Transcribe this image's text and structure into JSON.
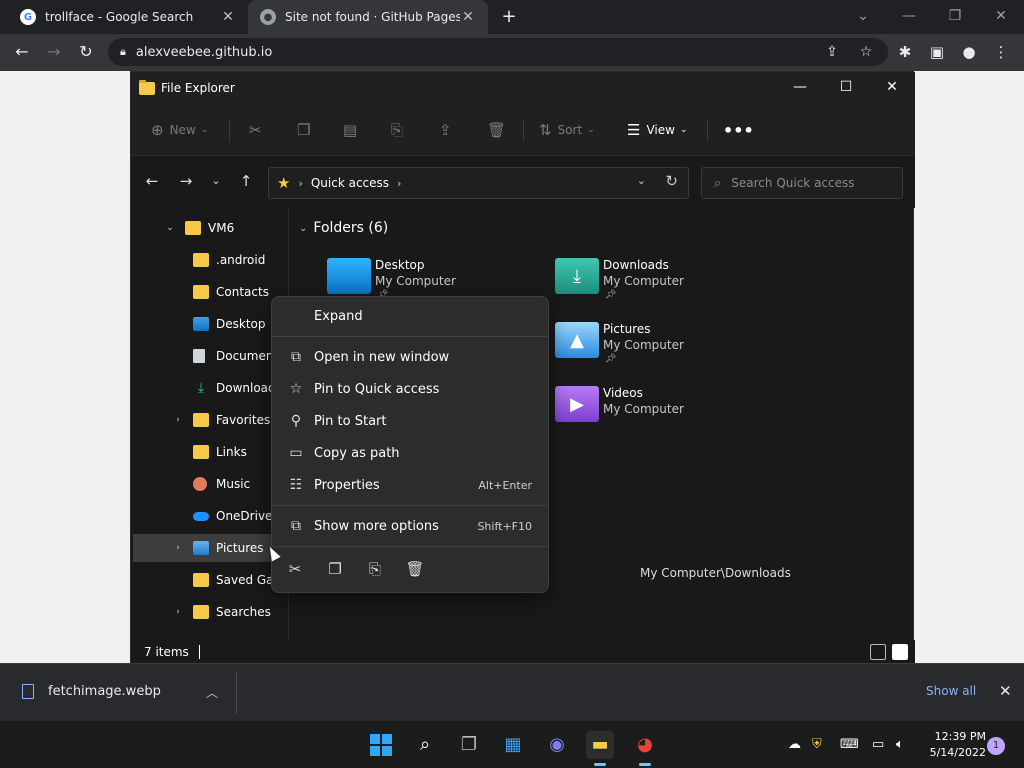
{
  "browser": {
    "tabs": [
      {
        "title": "trollface - Google Search",
        "favicon": "google-icon"
      },
      {
        "title": "Site not found · GitHub Pages",
        "favicon": "github-icon"
      }
    ],
    "url": "alexveebee.github.io"
  },
  "explorer": {
    "title": "File Explorer",
    "commands": {
      "new": "New",
      "sort": "Sort",
      "view": "View"
    },
    "breadcrumb": {
      "location": "Quick access"
    },
    "search_placeholder": "Search Quick access",
    "sidebar": [
      {
        "label": "VM6",
        "icon": "folder-icon",
        "expandable": "open"
      },
      {
        "label": ".android",
        "icon": "folder-icon"
      },
      {
        "label": "Contacts",
        "icon": "folder-icon"
      },
      {
        "label": "Desktop",
        "icon": "desktop-icon"
      },
      {
        "label": "Documents",
        "icon": "document-icon"
      },
      {
        "label": "Downloads",
        "icon": "download-icon"
      },
      {
        "label": "Favorites",
        "icon": "folder-icon",
        "expandable": "closed"
      },
      {
        "label": "Links",
        "icon": "folder-icon"
      },
      {
        "label": "Music",
        "icon": "music-icon"
      },
      {
        "label": "OneDrive",
        "icon": "cloud-icon"
      },
      {
        "label": "Pictures",
        "icon": "pictures-icon",
        "expandable": "closed",
        "selected": true
      },
      {
        "label": "Saved Games",
        "icon": "folder-icon"
      },
      {
        "label": "Searches",
        "icon": "folder-icon",
        "expandable": "closed"
      }
    ],
    "folders_header": "Folders (6)",
    "folders": [
      {
        "name": "Desktop",
        "location": "My Computer",
        "pinned": true
      },
      {
        "name": "Downloads",
        "location": "My Computer",
        "pinned": true
      },
      {
        "name": "Pictures",
        "location": "My Computer",
        "pinned": true
      },
      {
        "name": "Videos",
        "location": "My Computer",
        "pinned": false
      }
    ],
    "hover_path": "My Computer\\Downloads",
    "status": "7 items"
  },
  "context_menu": {
    "items": [
      {
        "label": "Expand",
        "icon": "",
        "shortcut": ""
      },
      {
        "label": "Open in new window",
        "icon": "open-window-icon",
        "shortcut": ""
      },
      {
        "label": "Pin to Quick access",
        "icon": "star-icon",
        "shortcut": ""
      },
      {
        "label": "Pin to Start",
        "icon": "pin-icon",
        "shortcut": ""
      },
      {
        "label": "Copy as path",
        "icon": "copy-path-icon",
        "shortcut": ""
      },
      {
        "label": "Properties",
        "icon": "properties-icon",
        "shortcut": "Alt+Enter"
      },
      {
        "label": "Show more options",
        "icon": "more-options-icon",
        "shortcut": "Shift+F10"
      }
    ]
  },
  "download_bar": {
    "file": "fetchimage.webp",
    "show_all": "Show all"
  },
  "taskbar": {
    "time": "12:39 PM",
    "date": "5/14/2022",
    "notifications": "1"
  }
}
